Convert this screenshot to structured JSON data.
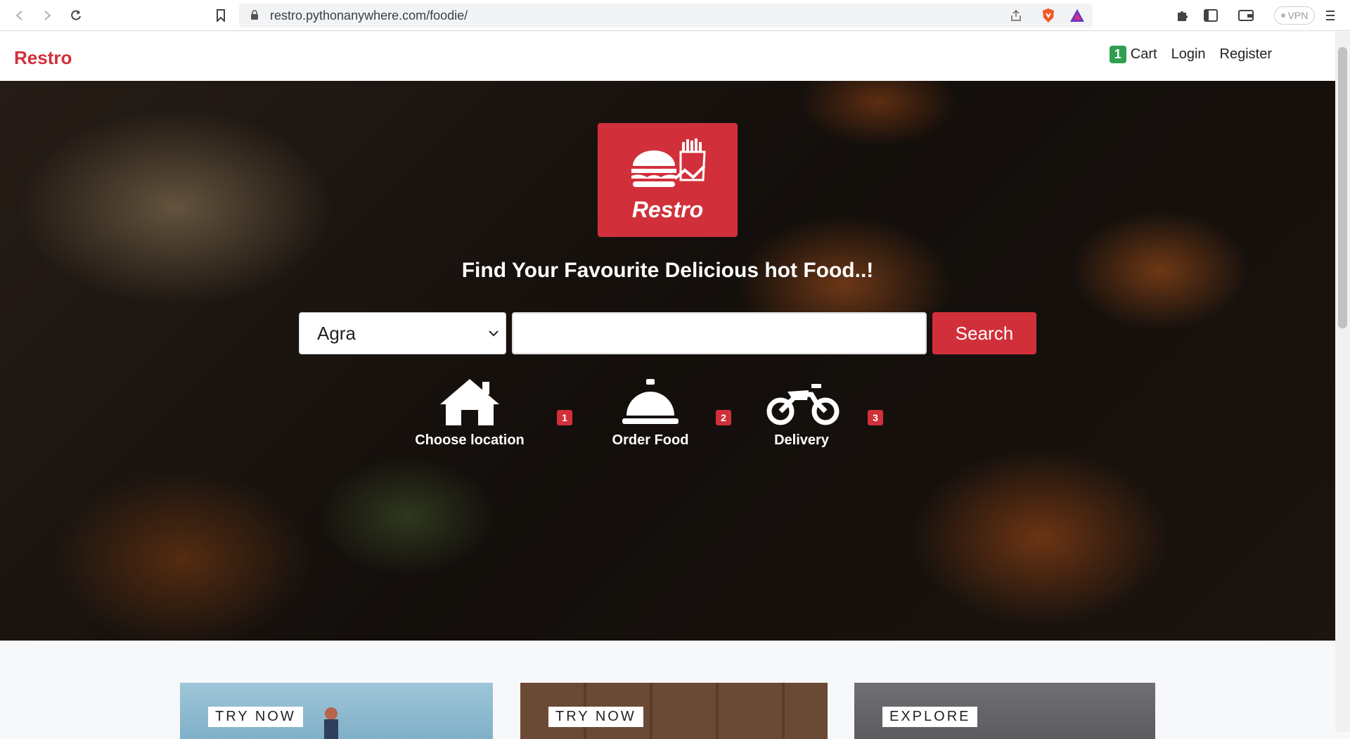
{
  "browser": {
    "url": "restro.pythonanywhere.com/foodie/",
    "vpn_label": "VPN"
  },
  "navbar": {
    "brand": "Restro",
    "cart_count": "1",
    "cart_label": "Cart",
    "login_label": "Login",
    "register_label": "Register"
  },
  "hero": {
    "logo_text": "Restro",
    "tagline": "Find Your Favourite Delicious hot Food..!",
    "city_selected": "Agra",
    "search_placeholder": "",
    "search_button": "Search",
    "steps": [
      {
        "label": "Choose location",
        "number": "1",
        "icon": "home-icon"
      },
      {
        "label": "Order Food",
        "number": "2",
        "icon": "service-bell-icon"
      },
      {
        "label": "Delivery",
        "number": "3",
        "icon": "motorcycle-icon"
      }
    ]
  },
  "cards": [
    {
      "label": "TRY NOW"
    },
    {
      "label": "TRY NOW"
    },
    {
      "label": "EXPLORE"
    }
  ],
  "colors": {
    "brand_red": "#d1303a",
    "cart_badge_green": "#2f9e4f"
  }
}
